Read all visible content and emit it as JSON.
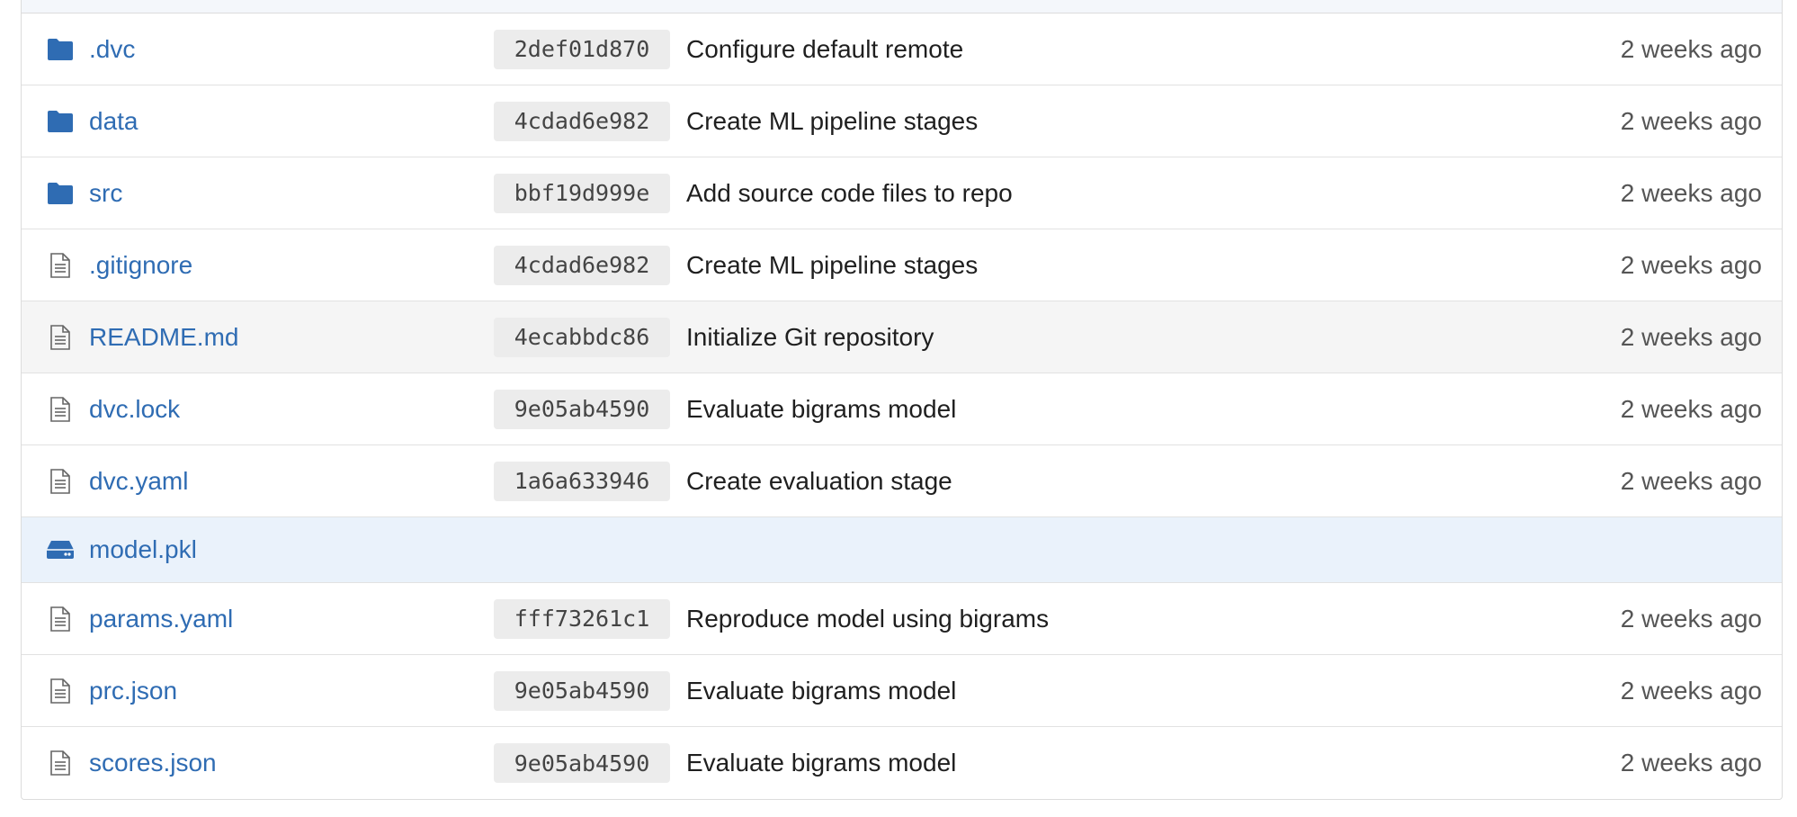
{
  "files": [
    {
      "name": ".dvc",
      "icon": "folder-icon",
      "commit": "2def01d870",
      "message": "Configure default remote",
      "time": "2 weeks ago"
    },
    {
      "name": "data",
      "icon": "folder-icon",
      "commit": "4cdad6e982",
      "message": "Create ML pipeline stages",
      "time": "2 weeks ago"
    },
    {
      "name": "src",
      "icon": "folder-icon",
      "commit": "bbf19d999e",
      "message": "Add source code files to repo",
      "time": "2 weeks ago"
    },
    {
      "name": ".gitignore",
      "icon": "file-icon",
      "commit": "4cdad6e982",
      "message": "Create ML pipeline stages",
      "time": "2 weeks ago"
    },
    {
      "name": "README.md",
      "icon": "file-icon",
      "commit": "4ecabbdc86",
      "message": "Initialize Git repository",
      "time": "2 weeks ago"
    },
    {
      "name": "dvc.lock",
      "icon": "file-icon",
      "commit": "9e05ab4590",
      "message": "Evaluate bigrams model",
      "time": "2 weeks ago"
    },
    {
      "name": "dvc.yaml",
      "icon": "file-icon",
      "commit": "1a6a633946",
      "message": "Create evaluation stage",
      "time": "2 weeks ago"
    },
    {
      "name": "model.pkl",
      "icon": "storage-drive-icon",
      "commit": "",
      "message": "",
      "time": ""
    },
    {
      "name": "params.yaml",
      "icon": "file-icon",
      "commit": "fff73261c1",
      "message": "Reproduce model using bigrams",
      "time": "2 weeks ago"
    },
    {
      "name": "prc.json",
      "icon": "file-icon",
      "commit": "9e05ab4590",
      "message": "Evaluate bigrams model",
      "time": "2 weeks ago"
    },
    {
      "name": "scores.json",
      "icon": "file-icon",
      "commit": "9e05ab4590",
      "message": "Evaluate bigrams model",
      "time": "2 weeks ago"
    }
  ],
  "colors": {
    "link": "#2f6cb3",
    "folder": "#2f6cb3",
    "highlight_row": "#eaf2fb",
    "hover_row": "#f5f5f5",
    "sha_bg": "#ececec"
  }
}
